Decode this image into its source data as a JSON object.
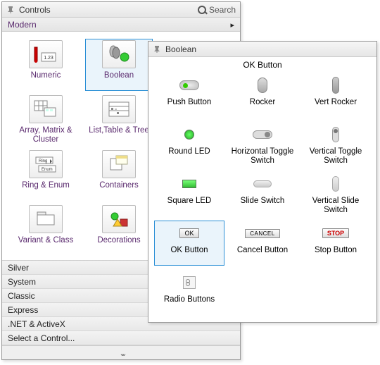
{
  "controls": {
    "title": "Controls",
    "search_label": "Search",
    "active_category": "Modern",
    "items": [
      {
        "label": "Numeric"
      },
      {
        "label": "Boolean",
        "selected": true
      },
      {
        "label": "Array, Matrix & Cluster"
      },
      {
        "label": "List,Table & Tree"
      },
      {
        "label": "Ring & Enum"
      },
      {
        "label": "Containers"
      },
      {
        "label": "Variant & Class"
      },
      {
        "label": "Decorations"
      }
    ],
    "other_categories": [
      "Silver",
      "System",
      "Classic",
      "Express",
      ".NET & ActiveX",
      "Select a Control..."
    ]
  },
  "boolean_panel": {
    "title": "Boolean",
    "heading": "OK Button",
    "items": [
      {
        "label": "Push Button"
      },
      {
        "label": "Rocker"
      },
      {
        "label": "Vert Rocker"
      },
      {
        "label": "Round LED"
      },
      {
        "label": "Horizontal Toggle Switch"
      },
      {
        "label": "Vertical Toggle Switch"
      },
      {
        "label": "Square LED"
      },
      {
        "label": "Slide Switch"
      },
      {
        "label": "Vertical Slide Switch"
      },
      {
        "label": "OK Button",
        "btn": "OK",
        "selected": true
      },
      {
        "label": "Cancel Button",
        "btn": "CANCEL"
      },
      {
        "label": "Stop Button",
        "btn": "STOP"
      },
      {
        "label": "Radio Buttons"
      }
    ]
  }
}
